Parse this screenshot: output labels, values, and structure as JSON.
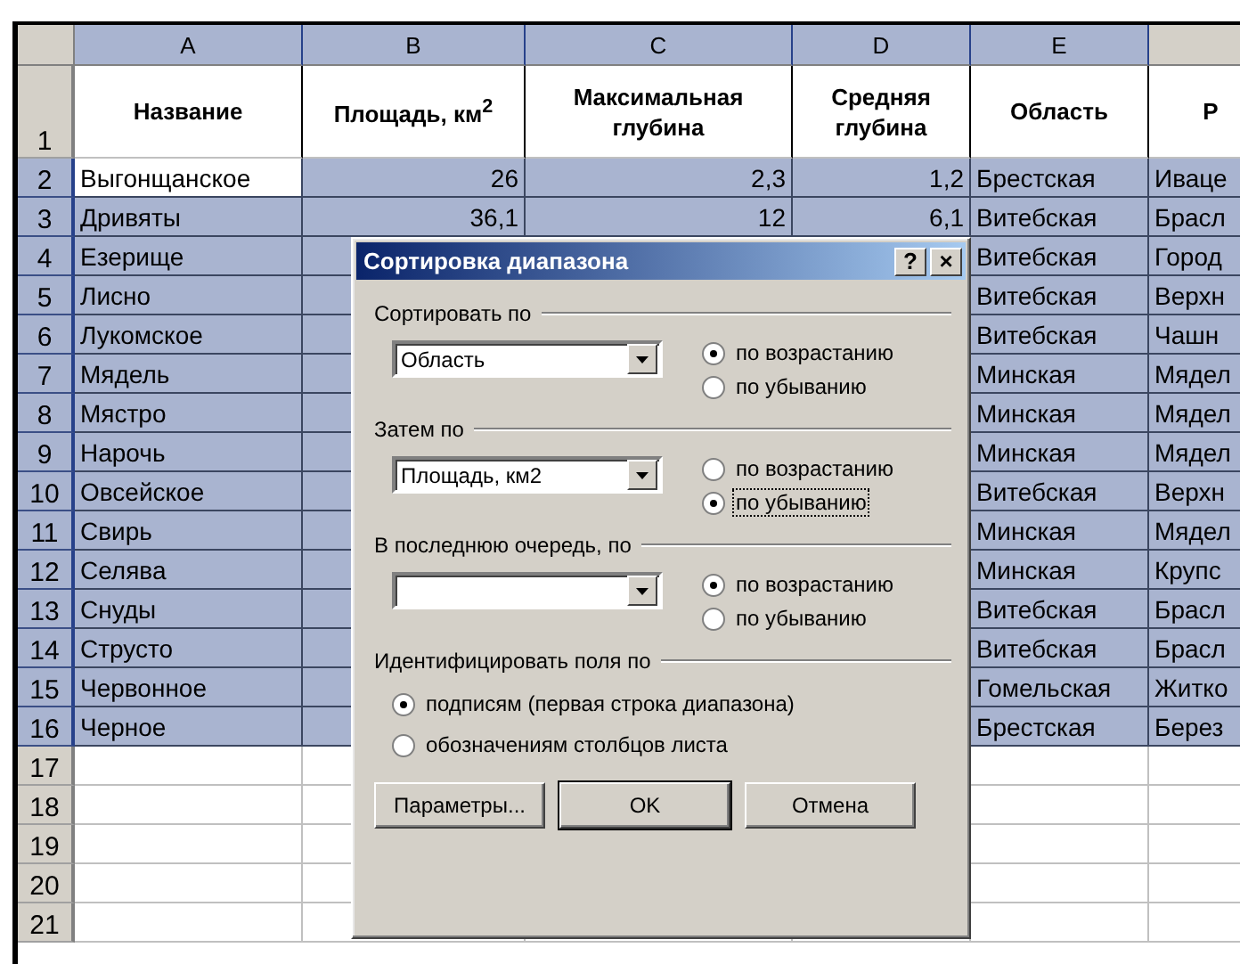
{
  "sheet": {
    "columns": [
      {
        "label": "A",
        "selected": true
      },
      {
        "label": "B",
        "selected": true
      },
      {
        "label": "C",
        "selected": true
      },
      {
        "label": "D",
        "selected": true
      },
      {
        "label": "E",
        "selected": true
      },
      {
        "selected": false
      }
    ],
    "header_row": {
      "num": "1",
      "cells": [
        "Название",
        "Площадь, км$^{2}$",
        "Максимальная глубина",
        "Средняя глубина",
        "Область",
        "Р"
      ]
    },
    "rows": [
      {
        "num": "2",
        "selected": true,
        "active": true,
        "cells": [
          "Выгонщанское",
          "26",
          "2,3",
          "1,2",
          "Брестская",
          "Иваце"
        ]
      },
      {
        "num": "3",
        "selected": true,
        "active": false,
        "cells": [
          "Дривяты",
          "36,1",
          "12",
          "6,1",
          "Витебская",
          "Брасл"
        ]
      },
      {
        "num": "4",
        "selected": true,
        "active": false,
        "cells": [
          "Езерище",
          null,
          null,
          null,
          "Витебская",
          "Город"
        ]
      },
      {
        "num": "5",
        "selected": true,
        "active": false,
        "cells": [
          "Лисно",
          null,
          null,
          null,
          "Витебская",
          "Верхн"
        ]
      },
      {
        "num": "6",
        "selected": true,
        "active": false,
        "cells": [
          "Лукомское",
          null,
          null,
          null,
          "Витебская",
          "Чашн"
        ]
      },
      {
        "num": "7",
        "selected": true,
        "active": false,
        "cells": [
          "Мядель",
          null,
          null,
          null,
          "Минская",
          "Мядел"
        ]
      },
      {
        "num": "8",
        "selected": true,
        "active": false,
        "cells": [
          "Мястро",
          null,
          null,
          null,
          "Минская",
          "Мядел"
        ]
      },
      {
        "num": "9",
        "selected": true,
        "active": false,
        "cells": [
          "Нарочь",
          null,
          null,
          null,
          "Минская",
          "Мядел"
        ]
      },
      {
        "num": "10",
        "selected": true,
        "active": false,
        "cells": [
          "Овсейское",
          null,
          null,
          null,
          "Витебская",
          "Верхн"
        ]
      },
      {
        "num": "11",
        "selected": true,
        "active": false,
        "cells": [
          "Свирь",
          null,
          null,
          null,
          "Минская",
          "Мядел"
        ]
      },
      {
        "num": "12",
        "selected": true,
        "active": false,
        "cells": [
          "Селява",
          null,
          null,
          null,
          "Минская",
          "Крупс"
        ]
      },
      {
        "num": "13",
        "selected": true,
        "active": false,
        "cells": [
          "Снуды",
          null,
          null,
          null,
          "Витебская",
          "Брасл"
        ]
      },
      {
        "num": "14",
        "selected": true,
        "active": false,
        "cells": [
          "Струсто",
          null,
          null,
          null,
          "Витебская",
          "Брасл"
        ]
      },
      {
        "num": "15",
        "selected": true,
        "active": false,
        "cells": [
          "Червонное",
          null,
          null,
          null,
          "Гомельская",
          "Житко"
        ]
      },
      {
        "num": "16",
        "selected": true,
        "active": false,
        "cells": [
          "Черное",
          null,
          null,
          null,
          "Брестская",
          "Берез"
        ]
      },
      {
        "num": "17",
        "selected": false,
        "active": false,
        "cells": [
          null,
          null,
          null,
          null,
          null,
          null
        ]
      },
      {
        "num": "18",
        "selected": false,
        "active": false,
        "cells": [
          null,
          null,
          null,
          null,
          null,
          null
        ]
      },
      {
        "num": "19",
        "selected": false,
        "active": false,
        "cells": [
          null,
          null,
          null,
          null,
          null,
          null
        ]
      },
      {
        "num": "20",
        "selected": false,
        "active": false,
        "cells": [
          null,
          null,
          null,
          null,
          null,
          null
        ]
      },
      {
        "num": "21",
        "selected": false,
        "active": false,
        "cells": [
          null,
          null,
          null,
          null,
          null,
          null
        ]
      }
    ]
  },
  "dialog": {
    "title": "Сортировка диапазона",
    "help": "?",
    "close": "×",
    "sort_groups": [
      {
        "label": "Сортировать по",
        "value": "Область",
        "options": [
          {
            "label": "по возрастанию",
            "selected": true,
            "focused": false
          },
          {
            "label": "по убыванию",
            "selected": false,
            "focused": false
          }
        ]
      },
      {
        "label": "Затем по",
        "value": "Площадь, км2",
        "options": [
          {
            "label": "по возрастанию",
            "selected": false,
            "focused": false
          },
          {
            "label": "по убыванию",
            "selected": true,
            "focused": true
          }
        ]
      },
      {
        "label": "В последнюю очередь, по",
        "options": [
          {
            "label": "по возрастанию",
            "selected": true,
            "focused": false
          },
          {
            "label": "по убыванию",
            "selected": false,
            "focused": false
          }
        ]
      }
    ],
    "identify": {
      "label": "Идентифицировать поля по",
      "options": [
        {
          "label": "подписям (первая строка диапазона)",
          "selected": true
        },
        {
          "label": "обозначениям столбцов листа",
          "selected": false
        }
      ]
    },
    "buttons": [
      {
        "label": "Параметры...",
        "default": false
      },
      {
        "label": "OK",
        "default": true
      },
      {
        "label": "Отмена",
        "default": false
      }
    ]
  }
}
